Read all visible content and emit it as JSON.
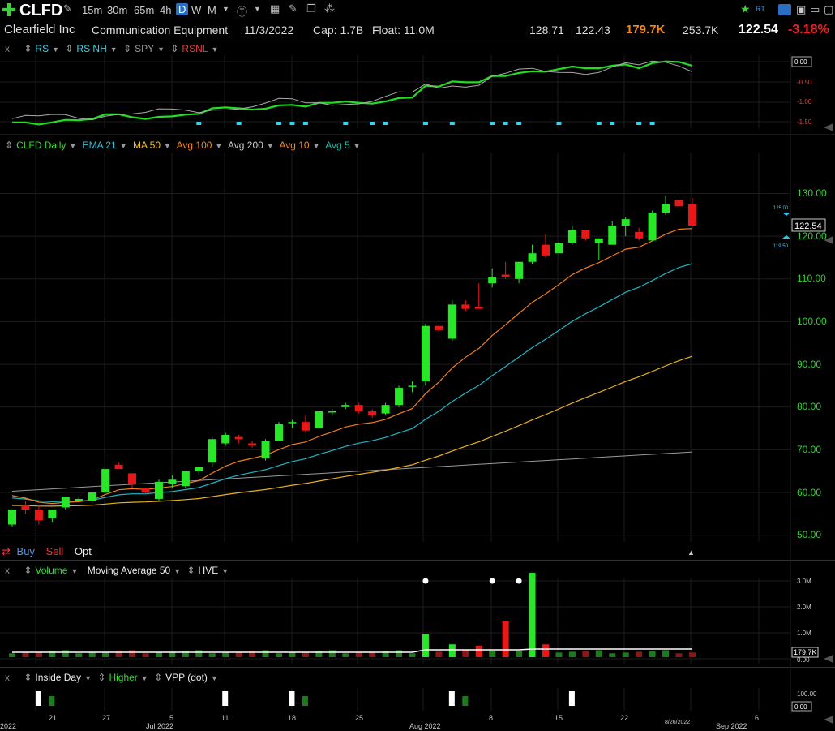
{
  "toolbar": {
    "ticker": "CLFD",
    "timeframes": [
      "15m",
      "30m",
      "65m",
      "4h",
      "D",
      "W",
      "M"
    ],
    "active_timeframe": "D",
    "rt_label": "RT"
  },
  "info": {
    "company": "Clearfield Inc",
    "industry": "Communication Equipment",
    "date": "11/3/2022",
    "cap": "Cap: 1.7B",
    "float": "Float: 11.0M",
    "high": "128.71",
    "low": "122.43",
    "volume": "179.7K",
    "avg_volume": "253.7K",
    "last": "122.54",
    "change": "-3.18%"
  },
  "rs_panel": {
    "close": "x",
    "items": [
      "RS",
      "RS NH",
      "SPY",
      "RSNL"
    ],
    "axis": [
      "0.00",
      "-0.50",
      "-1.00",
      "-1.50"
    ]
  },
  "price_panel": {
    "items": [
      "CLFD Daily",
      "EMA 21",
      "MA 50",
      "Avg 100",
      "Avg 200",
      "Avg 10",
      "Avg 5"
    ],
    "axis": [
      "130.00",
      "120.00",
      "110.00",
      "100.00",
      "90.00",
      "80.00",
      "70.00",
      "60.00",
      "50.00"
    ],
    "last_price": "122.54",
    "marker_high": "125.00",
    "marker_low": "119.50",
    "buy": "Buy",
    "sell": "Sell",
    "opt": "Opt"
  },
  "volume_panel": {
    "close": "x",
    "items": [
      "Volume",
      "Moving Average 50",
      "HVE"
    ],
    "axis": [
      "3.0M",
      "2.0M",
      "1.0M",
      "0.00"
    ],
    "last_volume": "179.7K"
  },
  "inside_panel": {
    "close": "x",
    "items": [
      "Inside Day",
      "Higher",
      "VPP (dot)"
    ],
    "axis": [
      "100.00",
      "0.00"
    ]
  },
  "x_axis": {
    "labels": [
      "2022",
      "21",
      "27",
      "Jul 2022",
      "5",
      "11",
      "18",
      "25",
      "Aug 2022",
      "8",
      "15",
      "22",
      "6"
    ],
    "date_tag": "8/26/2022",
    "sep_label": "Sep 2022"
  },
  "colors": {
    "up": "#28e628",
    "down": "#e81818",
    "ema21": "#1fb6c8",
    "ma50": "#e8b21c",
    "avg10": "#f07e1e",
    "avg200": "#9a9a9a",
    "rs_line": "#22dd22"
  },
  "chart_data": {
    "type": "candlestick",
    "candles": [
      {
        "o": 52.5,
        "h": 56,
        "l": 52,
        "c": 56
      },
      {
        "o": 57,
        "h": 58,
        "l": 55,
        "c": 56
      },
      {
        "o": 56,
        "h": 57,
        "l": 52.5,
        "c": 53.5
      },
      {
        "o": 54,
        "h": 56,
        "l": 53,
        "c": 56
      },
      {
        "o": 56.5,
        "h": 59,
        "l": 56,
        "c": 59
      },
      {
        "o": 58,
        "h": 59,
        "l": 58,
        "c": 58.5
      },
      {
        "o": 58,
        "h": 60,
        "l": 57.5,
        "c": 60
      },
      {
        "o": 60,
        "h": 65.5,
        "l": 60,
        "c": 65.5
      },
      {
        "o": 66.5,
        "h": 67,
        "l": 65.5,
        "c": 65.5
      },
      {
        "o": 64.5,
        "h": 64.5,
        "l": 61,
        "c": 62
      },
      {
        "o": 61,
        "h": 61,
        "l": 59.5,
        "c": 60
      },
      {
        "o": 58.5,
        "h": 63,
        "l": 58,
        "c": 62.5
      },
      {
        "o": 62,
        "h": 64,
        "l": 61,
        "c": 63
      },
      {
        "o": 61.5,
        "h": 65,
        "l": 61,
        "c": 65
      },
      {
        "o": 65,
        "h": 66,
        "l": 64,
        "c": 66
      },
      {
        "o": 67,
        "h": 73,
        "l": 66,
        "c": 72.5
      },
      {
        "o": 71.5,
        "h": 74,
        "l": 71,
        "c": 73.5
      },
      {
        "o": 73,
        "h": 73.5,
        "l": 71.5,
        "c": 72.5
      },
      {
        "o": 71.5,
        "h": 72,
        "l": 70.5,
        "c": 71
      },
      {
        "o": 68,
        "h": 72.5,
        "l": 67.5,
        "c": 72
      },
      {
        "o": 72,
        "h": 76.5,
        "l": 72,
        "c": 76
      },
      {
        "o": 76.5,
        "h": 77,
        "l": 75,
        "c": 76.5
      },
      {
        "o": 76.5,
        "h": 78,
        "l": 74,
        "c": 74.5
      },
      {
        "o": 75,
        "h": 79,
        "l": 75,
        "c": 79
      },
      {
        "o": 79,
        "h": 79.5,
        "l": 78,
        "c": 79
      },
      {
        "o": 80,
        "h": 81,
        "l": 79.5,
        "c": 80.5
      },
      {
        "o": 80.5,
        "h": 81,
        "l": 78.5,
        "c": 79
      },
      {
        "o": 79,
        "h": 79.5,
        "l": 77.5,
        "c": 78
      },
      {
        "o": 78.5,
        "h": 81,
        "l": 78,
        "c": 80.5
      },
      {
        "o": 80.5,
        "h": 85,
        "l": 80,
        "c": 84.5
      },
      {
        "o": 85,
        "h": 86,
        "l": 83.5,
        "c": 85
      },
      {
        "o": 86,
        "h": 99.5,
        "l": 85,
        "c": 99
      },
      {
        "o": 99,
        "h": 99.5,
        "l": 97,
        "c": 98
      },
      {
        "o": 96,
        "h": 105,
        "l": 95.5,
        "c": 104
      },
      {
        "o": 104,
        "h": 105,
        "l": 102.5,
        "c": 103
      },
      {
        "o": 103.5,
        "h": 109,
        "l": 103,
        "c": 103
      },
      {
        "o": 109,
        "h": 112.5,
        "l": 108,
        "c": 110.5
      },
      {
        "o": 111,
        "h": 114,
        "l": 110,
        "c": 110.5
      },
      {
        "o": 110,
        "h": 114,
        "l": 109,
        "c": 114
      },
      {
        "o": 114,
        "h": 118,
        "l": 113.5,
        "c": 116
      },
      {
        "o": 118,
        "h": 120.5,
        "l": 115,
        "c": 115.5
      },
      {
        "o": 116,
        "h": 119,
        "l": 114.5,
        "c": 118.5
      },
      {
        "o": 118.5,
        "h": 122.5,
        "l": 118,
        "c": 121.5
      },
      {
        "o": 121.5,
        "h": 121.5,
        "l": 119,
        "c": 119.5
      },
      {
        "o": 118.5,
        "h": 119.5,
        "l": 114.5,
        "c": 119.5
      },
      {
        "o": 118,
        "h": 123.5,
        "l": 118,
        "c": 122.5
      },
      {
        "o": 122.5,
        "h": 124.5,
        "l": 120,
        "c": 124
      },
      {
        "o": 121,
        "h": 122,
        "l": 119,
        "c": 119.5
      },
      {
        "o": 119,
        "h": 126,
        "l": 119,
        "c": 125.5
      },
      {
        "o": 125.5,
        "h": 129.5,
        "l": 125,
        "c": 127.5
      },
      {
        "o": 128.5,
        "h": 130,
        "l": 126.5,
        "c": 127
      },
      {
        "o": 127.5,
        "h": 129,
        "l": 122,
        "c": 122.5
      }
    ],
    "ylim": [
      47,
      136
    ]
  }
}
